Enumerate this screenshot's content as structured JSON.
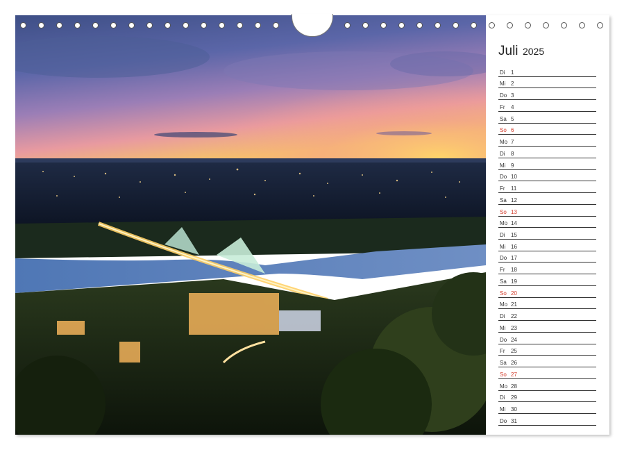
{
  "calendar": {
    "month": "Juli",
    "year": "2025",
    "days": [
      {
        "wd": "Di",
        "d": "1"
      },
      {
        "wd": "Mi",
        "d": "2"
      },
      {
        "wd": "Do",
        "d": "3"
      },
      {
        "wd": "Fr",
        "d": "4"
      },
      {
        "wd": "Sa",
        "d": "5"
      },
      {
        "wd": "So",
        "d": "6"
      },
      {
        "wd": "Mo",
        "d": "7"
      },
      {
        "wd": "Di",
        "d": "8"
      },
      {
        "wd": "Mi",
        "d": "9"
      },
      {
        "wd": "Do",
        "d": "10"
      },
      {
        "wd": "Fr",
        "d": "11"
      },
      {
        "wd": "Sa",
        "d": "12"
      },
      {
        "wd": "So",
        "d": "13"
      },
      {
        "wd": "Mo",
        "d": "14"
      },
      {
        "wd": "Di",
        "d": "15"
      },
      {
        "wd": "Mi",
        "d": "16"
      },
      {
        "wd": "Do",
        "d": "17"
      },
      {
        "wd": "Fr",
        "d": "18"
      },
      {
        "wd": "Sa",
        "d": "19"
      },
      {
        "wd": "So",
        "d": "20"
      },
      {
        "wd": "Mo",
        "d": "21"
      },
      {
        "wd": "Di",
        "d": "22"
      },
      {
        "wd": "Mi",
        "d": "23"
      },
      {
        "wd": "Do",
        "d": "24"
      },
      {
        "wd": "Fr",
        "d": "25"
      },
      {
        "wd": "Sa",
        "d": "26"
      },
      {
        "wd": "So",
        "d": "27"
      },
      {
        "wd": "Mo",
        "d": "28"
      },
      {
        "wd": "Di",
        "d": "29"
      },
      {
        "wd": "Mi",
        "d": "30"
      },
      {
        "wd": "Do",
        "d": "31"
      }
    ]
  },
  "colors": {
    "sunday": "#d23b2a",
    "text": "#333333"
  }
}
